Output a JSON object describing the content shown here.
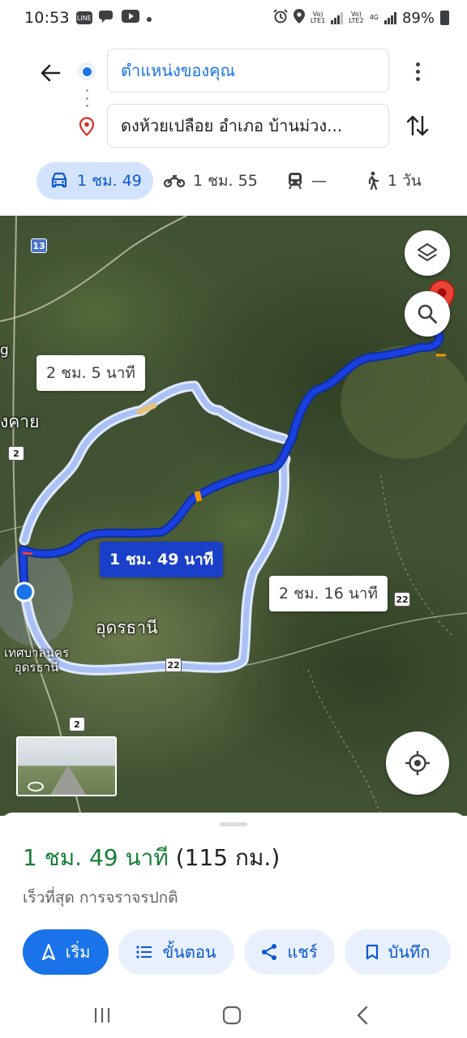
{
  "status_bar": {
    "time": "10:53",
    "sim1_label": "LTE1",
    "sim2_label": "LTE2",
    "network": "4G",
    "battery": "89%"
  },
  "route": {
    "origin": "ตำแหน่งของคุณ",
    "destination": "ดงห้วยเปลือย อำเภอ บ้านม่วง..."
  },
  "modes": [
    {
      "name": "car",
      "icon": "car-icon",
      "label": "1 ชม. 49",
      "active": true
    },
    {
      "name": "motorcycle",
      "icon": "motorcycle-icon",
      "label": "1 ชม. 55",
      "active": false
    },
    {
      "name": "transit",
      "icon": "train-icon",
      "label": "—",
      "active": false
    },
    {
      "name": "walk",
      "icon": "walking-icon",
      "label": "1 วัน",
      "active": false
    }
  ],
  "map": {
    "route_labels": {
      "alt_north": "2 ชม. 5 นาที",
      "main": "1 ชม. 49 นาที",
      "alt_south": "2 ชม. 16 นาที"
    },
    "places": {
      "nong_khai": "งคาย",
      "udon_thani": "อุดรธานี",
      "udon_municipality_line1": "เทศบาลนคร",
      "udon_municipality_line2": "อุดรธานี",
      "edge_letter": "g"
    },
    "shields": [
      "13",
      "2",
      "22",
      "2",
      "22"
    ],
    "colors": {
      "main_route": "#1a40e0",
      "alt_route": "#a9c1f5",
      "destination_pin": "#ea4335"
    }
  },
  "summary": {
    "duration": "1 ชม. 49 นาที",
    "distance": "(115 กม.)",
    "subtitle": "เร็วที่สุด การจราจรปกติ"
  },
  "actions": {
    "start": "เริ่ม",
    "steps": "ขั้นตอน",
    "share": "แชร์",
    "save": "บันทึก"
  }
}
